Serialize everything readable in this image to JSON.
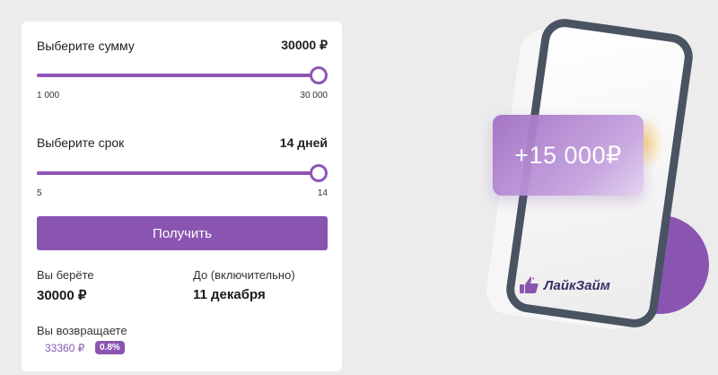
{
  "calculator": {
    "amount": {
      "label": "Выберите сумму",
      "value": "30000 ₽",
      "min_label": "1 000",
      "max_label": "30 000",
      "min": 1000,
      "max": 30000,
      "current": 30000
    },
    "term": {
      "label": "Выберите срок",
      "value": "14 дней",
      "min_label": "5",
      "max_label": "14",
      "min": 5,
      "max": 14,
      "current": 14
    },
    "submit_label": "Получить",
    "summary": {
      "take_label": "Вы берёте",
      "take_value": "30000 ₽",
      "until_label": "До (включительно)",
      "until_value": "11 декабря",
      "return_label": "Вы возвращаете",
      "return_value": "33360 ₽",
      "rate_badge": "0.8%"
    }
  },
  "promo": {
    "amount_text": "+15 000₽",
    "brand": "ЛайкЗайм",
    "brand_icon": "thumbs-up-icon",
    "colors": {
      "accent": "#8a55b1",
      "phone_frame": "#4a5361"
    }
  }
}
